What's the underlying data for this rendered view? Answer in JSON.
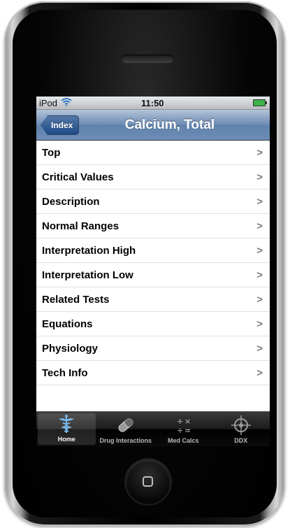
{
  "status_bar": {
    "carrier": "iPod",
    "time": "11:50"
  },
  "nav_bar": {
    "back_label": "Index",
    "title": "Calcium, Total"
  },
  "list": {
    "items": [
      {
        "label": "Top"
      },
      {
        "label": "Critical Values"
      },
      {
        "label": "Description"
      },
      {
        "label": "Normal Ranges"
      },
      {
        "label": "Interpretation High"
      },
      {
        "label": "Interpretation Low"
      },
      {
        "label": "Related Tests"
      },
      {
        "label": "Equations"
      },
      {
        "label": "Physiology"
      },
      {
        "label": "Tech Info"
      }
    ],
    "chevron": ">"
  },
  "tab_bar": {
    "tabs": [
      {
        "label": "Home",
        "icon": "caduceus-icon",
        "active": true
      },
      {
        "label": "Drug Interactions",
        "icon": "capsule-icon",
        "active": false
      },
      {
        "label": "Med Calcs",
        "icon": "calculator-icon",
        "active": false
      },
      {
        "label": "DDX",
        "icon": "crosshair-icon",
        "active": false
      }
    ]
  },
  "colors": {
    "nav_bar": "#6d8db6",
    "back_button": "#1e4a86",
    "tab_bar": "#000000",
    "battery": "#3bb34a"
  }
}
